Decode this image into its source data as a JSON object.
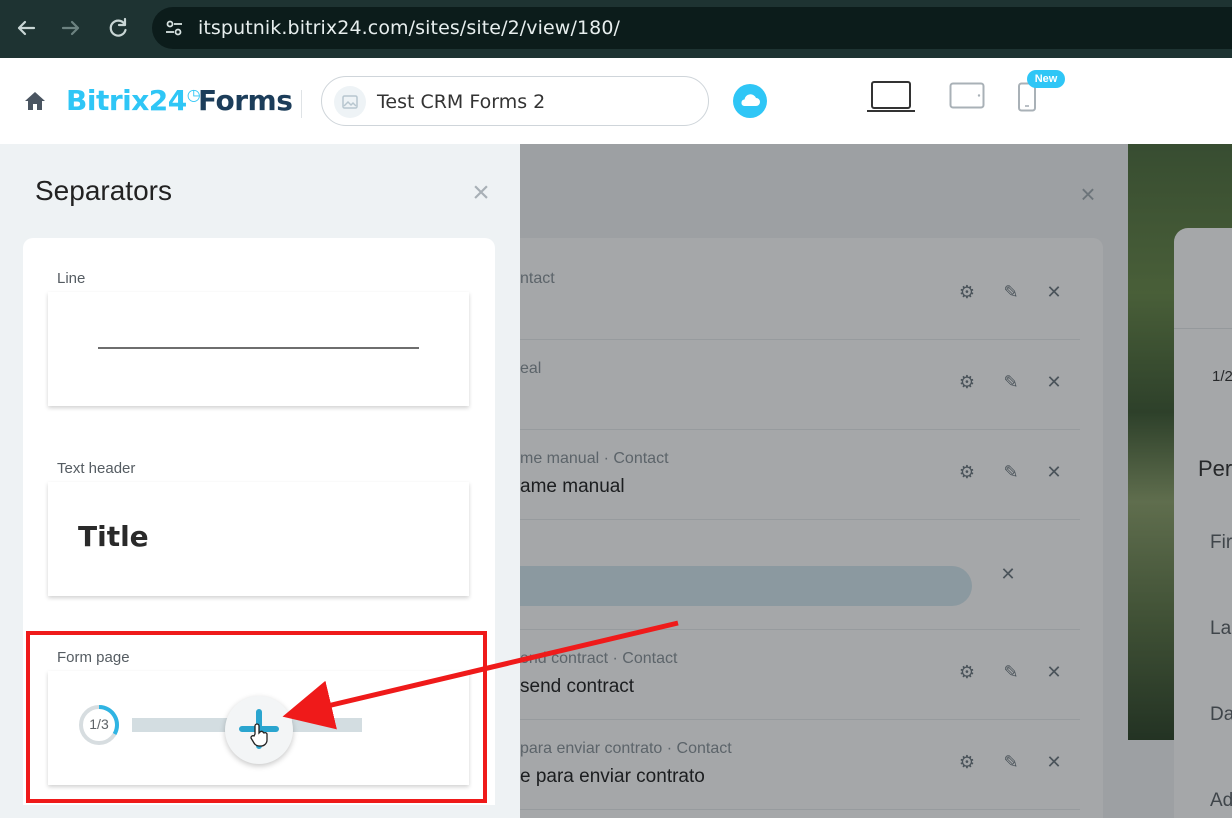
{
  "browser": {
    "url": "itsputnik.bitrix24.com/sites/site/2/view/180/",
    "back_icon": "arrow-left-icon",
    "forward_icon": "arrow-right-icon",
    "reload_icon": "reload-icon",
    "site_info_icon": "tune-icon"
  },
  "header": {
    "logo_brand": "Bitrix24",
    "logo_product": "Forms",
    "form_name": "Test CRM Forms 2",
    "devices": [
      "laptop-icon",
      "tablet-icon",
      "phone-icon"
    ],
    "new_badge": "New",
    "colors": {
      "accent": "#2fc6f6",
      "brand_dark": "#1c3d5a"
    }
  },
  "panel": {
    "title": "Separators",
    "items": [
      {
        "label": "Line"
      },
      {
        "label": "Text header",
        "sample": "Title"
      },
      {
        "label": "Form page",
        "progress": "1/3"
      }
    ]
  },
  "editor": {
    "fields": [
      {
        "sub": "ntact",
        "main": ""
      },
      {
        "sub": "eal",
        "main": ""
      },
      {
        "sub": "me manual · Contact",
        "main": "ame manual"
      },
      {
        "sub": "",
        "main": ""
      },
      {
        "sub": "end contract · Contact",
        "main": "send contract"
      },
      {
        "sub": "para enviar contrato · Contact",
        "main": "e para enviar contrato"
      }
    ],
    "preview": {
      "progress": "1/2",
      "heading": "Per",
      "fields": [
        "Fir",
        "La",
        "Da",
        "Ad"
      ]
    }
  }
}
